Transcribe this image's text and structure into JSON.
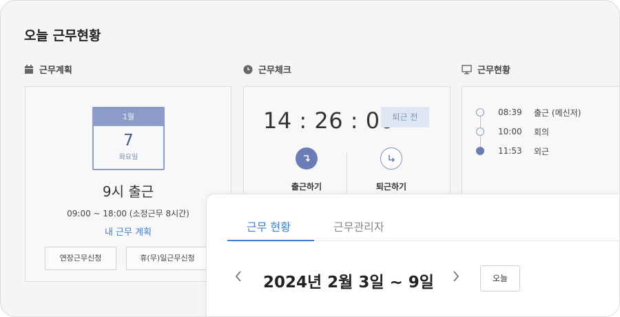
{
  "page": {
    "title": "오늘 근무현황"
  },
  "sections": {
    "plan": {
      "heading": "근무계획",
      "icon": "calendar-icon"
    },
    "check": {
      "heading": "근무체크",
      "icon": "clock-icon"
    },
    "status": {
      "heading": "근무현황",
      "icon": "monitor-icon"
    }
  },
  "plan": {
    "calendar": {
      "month": "1월",
      "day": "7",
      "weekday": "화요일"
    },
    "main_text": "9시 출근",
    "hours": "09:00 ~ 18:00 (소정근무 8시간)",
    "link": "내 근무 계획",
    "buttons": {
      "overtime": "연장근무신청",
      "holiday": "휴(무)일근무신청"
    }
  },
  "check": {
    "time": "14 : 26 : 00",
    "badge": "퇴근 전",
    "clock_in": {
      "label": "출근하기",
      "icon": "clock-in-icon"
    },
    "clock_out": {
      "label": "퇴근하기",
      "icon": "clock-out-icon"
    }
  },
  "timeline": [
    {
      "time": "08:39",
      "label": "출근 (메신저)",
      "filled": false
    },
    {
      "time": "10:00",
      "label": "회의",
      "filled": false
    },
    {
      "time": "11:53",
      "label": "외근",
      "filled": true
    }
  ],
  "overlay": {
    "tabs": [
      {
        "label": "근무 현황",
        "active": true
      },
      {
        "label": "근무관리자",
        "active": false
      }
    ],
    "week_label": "2024년 2월 3일 ~ 9일",
    "today_button": "오늘",
    "prev_icon": "chevron-left-icon",
    "next_icon": "chevron-right-icon"
  },
  "colors": {
    "accent": "#3c7fd0",
    "calendar": "#8c9bc7",
    "clock_in_circle": "#6a7db7"
  }
}
